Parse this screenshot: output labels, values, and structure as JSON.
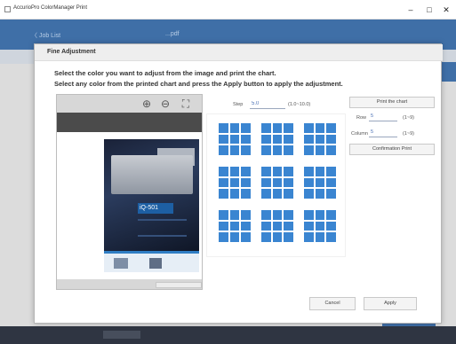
{
  "window": {
    "title": "AccurioPro ColorManager Print",
    "min_glyph": "–",
    "max_glyph": "□",
    "close_glyph": "✕"
  },
  "background": {
    "back_label": "〈 Job List",
    "file_label": "...pdf"
  },
  "dialog": {
    "title": "Fine Adjustment",
    "instruction_1": "Select the color you want to adjust from the image and print the chart.",
    "instruction_2": "Select any color from the printed chart and press the Apply button to apply the adjustment.",
    "zoom_in_glyph": "⊕",
    "zoom_out_glyph": "⊖",
    "fit_glyph": "⛶",
    "preview_banner_text": "iQ-501",
    "step": {
      "label": "Step",
      "value": "5.0",
      "range": "(1.0~10.0)"
    },
    "print_chart_label": "Print the chart",
    "row": {
      "label": "Row",
      "value": "5",
      "range": "(1~9)"
    },
    "columns": {
      "label": "Column",
      "value": "5",
      "range": "(1~9)"
    },
    "confirmation_print_label": "Confirmation Print",
    "cancel_label": "Cancel",
    "apply_label": "Apply"
  },
  "colors": {
    "patch_blue": "#3a85d1",
    "header_blue": "#3f6fa7",
    "footer_dark": "#2f3542"
  },
  "icons": [
    "app-icon",
    "zoom-in-icon",
    "zoom-out-icon",
    "fit-to-window-icon"
  ]
}
